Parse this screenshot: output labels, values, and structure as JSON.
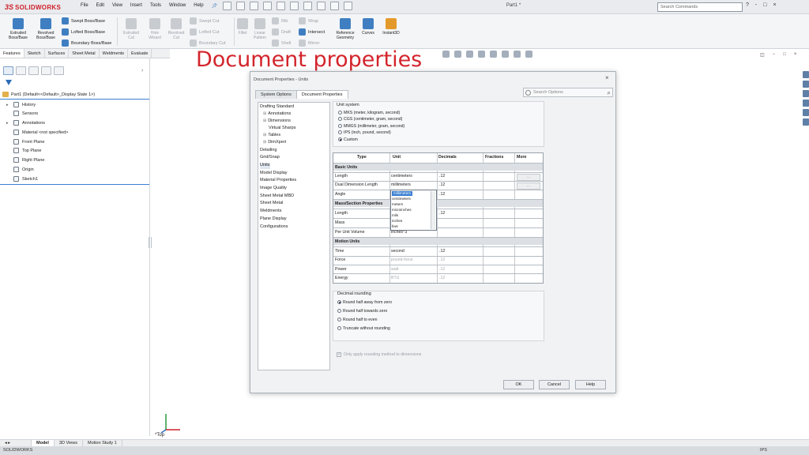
{
  "app": {
    "logo_ds": "3S",
    "logo_text": "SOLIDWORKS",
    "menus": [
      "File",
      "Edit",
      "View",
      "Insert",
      "Tools",
      "Window",
      "Help"
    ],
    "document_title": "Part1 *",
    "search_placeholder": "Search Commands",
    "window_controls": [
      "?",
      "-",
      "□",
      "×"
    ]
  },
  "ribbon": {
    "extruded": "Extruded Boss/Base",
    "revolved": "Revolved Boss/Base",
    "swept": "Swept Boss/Base",
    "lofted": "Lofted Boss/Base",
    "boundary": "Boundary Boss/Base",
    "extruded_cut": "Extruded Cut",
    "hole_wizard": "Hole Wizard",
    "revolved_cut": "Revolved Cut",
    "swept_cut": "Swept Cut",
    "lofted_cut": "Lofted Cut",
    "boundary_cut": "Boundary Cut",
    "fillet": "Fillet",
    "linear_pattern": "Linear Pattern",
    "rib": "Rib",
    "draft": "Draft",
    "shell": "Shell",
    "wrap": "Wrap",
    "intersect": "Intersect",
    "mirror": "Mirror",
    "ref_geometry": "Reference Geometry",
    "curves": "Curves",
    "instant3d": "Instant3D"
  },
  "tabs": [
    "Features",
    "Sketch",
    "Surfaces",
    "Sheet Metal",
    "Weldments",
    "Evaluate"
  ],
  "annotation": "Document properties",
  "tree": {
    "part": "Part1  (Default<<Default>_Display State 1>)",
    "items": [
      "History",
      "Sensors",
      "Annotations",
      "Material <not specified>",
      "Front Plane",
      "Top Plane",
      "Right Plane",
      "Origin",
      "Sketch1"
    ]
  },
  "view_name": "*Top",
  "bottom_tabs": [
    "Model",
    "3D Views",
    "Motion Study 1"
  ],
  "status": {
    "app": "SOLIDWORKS",
    "units": "IPS"
  },
  "dialog": {
    "title": "Document Properties - Units",
    "tabs": [
      "System Options",
      "Document Properties"
    ],
    "search_placeholder": "Search Options",
    "categories": [
      "Drafting Standard",
      "Annotations",
      "Dimensions",
      "Virtual Sharps",
      "Tables",
      "DimXpert",
      "Detailing",
      "Grid/Snap",
      "Units",
      "Model Display",
      "Material Properties",
      "Image Quality",
      "Sheet Metal MBD",
      "Sheet Metal",
      "Weldments",
      "Plane Display",
      "Configurations"
    ],
    "unit_system_label": "Unit system",
    "unit_systems": [
      "MKS  (meter, kilogram, second)",
      "CGS  (centimeter, gram, second)",
      "MMGS (millimeter, gram, second)",
      "IPS  (inch, pound, second)",
      "Custom"
    ],
    "table_headers": [
      "Type",
      "Unit",
      "Decimals",
      "Fractions",
      "More"
    ],
    "basic_units_label": "Basic Units",
    "basic_units": [
      {
        "type": "Length",
        "unit": "centimeters",
        "decimals": ".12"
      },
      {
        "type": "Dual Dimension Length",
        "unit": "millimeters",
        "decimals": ".12"
      },
      {
        "type": "Angle",
        "unit": "",
        "decimals": ".12"
      }
    ],
    "mass_label": "Mass/Section Properties",
    "mass_units": [
      {
        "type": "Length",
        "unit": "",
        "decimals": ".12"
      },
      {
        "type": "Mass",
        "unit": "",
        "decimals": ""
      },
      {
        "type": "Per Unit Volume",
        "unit": "inches^3",
        "decimals": ""
      }
    ],
    "motion_label": "Motion Units",
    "motion_units": [
      {
        "type": "Time",
        "unit": "second",
        "decimals": ".12"
      },
      {
        "type": "Force",
        "unit": "pound-force",
        "decimals": ".12"
      },
      {
        "type": "Power",
        "unit": "watt",
        "decimals": ".12"
      },
      {
        "type": "Energy",
        "unit": "BTU",
        "decimals": ".12"
      }
    ],
    "dropdown_options": [
      "millimeters",
      "centimeters",
      "meters",
      "microinches",
      "mils",
      "inches",
      "feet"
    ],
    "more_button": "...",
    "rounding_label": "Decimal rounding",
    "rounding_options": [
      "Round half away from zero",
      "Round half towards zero",
      "Round half to even",
      "Truncate without rounding"
    ],
    "apply_rounding": "Only apply rounding method to dimensions",
    "buttons": {
      "ok": "OK",
      "cancel": "Cancel",
      "help": "Help"
    }
  },
  "colors": {
    "brand": "#d0202a",
    "annotation": "#d3242b",
    "selection": "#3b7fd1"
  }
}
